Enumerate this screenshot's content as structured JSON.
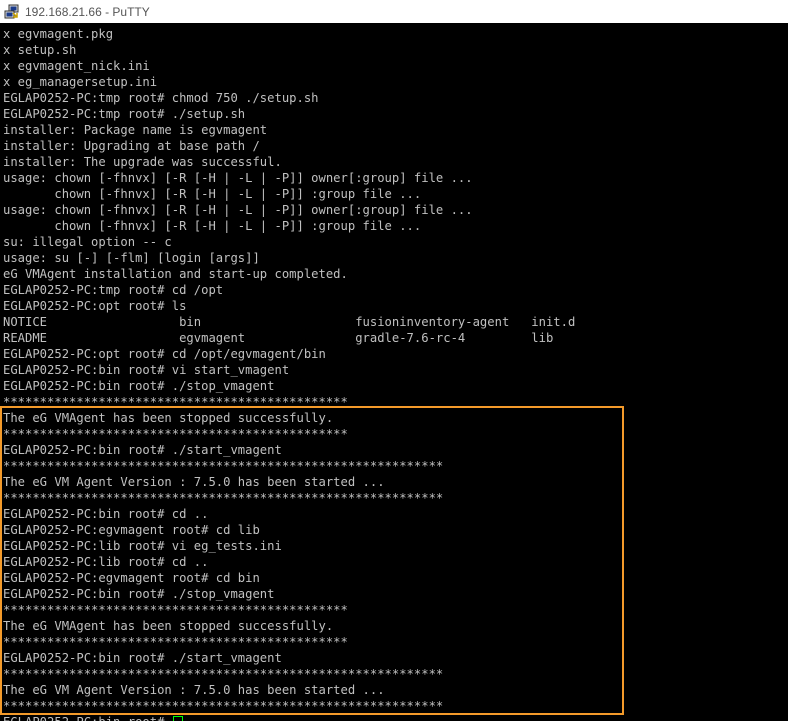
{
  "window": {
    "title": "192.168.21.66 - PuTTY",
    "icon": "putty-icon"
  },
  "terminal": {
    "lines": [
      "x egvmagent.pkg",
      "x setup.sh",
      "x egvmagent_nick.ini",
      "x eg_managersetup.ini",
      "EGLAP0252-PC:tmp root# chmod 750 ./setup.sh",
      "EGLAP0252-PC:tmp root# ./setup.sh",
      "installer: Package name is egvmagent",
      "installer: Upgrading at base path /",
      "installer: The upgrade was successful.",
      "usage: chown [-fhnvx] [-R [-H | -L | -P]] owner[:group] file ...",
      "       chown [-fhnvx] [-R [-H | -L | -P]] :group file ...",
      "usage: chown [-fhnvx] [-R [-H | -L | -P]] owner[:group] file ...",
      "       chown [-fhnvx] [-R [-H | -L | -P]] :group file ...",
      "su: illegal option -- c",
      "usage: su [-] [-flm] [login [args]]",
      "eG VMAgent installation and start-up completed.",
      "EGLAP0252-PC:tmp root# cd /opt",
      "EGLAP0252-PC:opt root# ls",
      "NOTICE                  bin                     fusioninventory-agent   init.d",
      "README                  egvmagent               gradle-7.6-rc-4         lib",
      "EGLAP0252-PC:opt root# cd /opt/egvmagent/bin",
      "EGLAP0252-PC:bin root# vi start_vmagent",
      "EGLAP0252-PC:bin root# ./stop_vmagent",
      "***********************************************",
      "The eG VMAgent has been stopped successfully.",
      "***********************************************",
      "EGLAP0252-PC:bin root# ./start_vmagent",
      "************************************************************",
      "The eG VM Agent Version : 7.5.0 has been started ...",
      "************************************************************",
      "EGLAP0252-PC:bin root# cd ..",
      "EGLAP0252-PC:egvmagent root# cd lib",
      "EGLAP0252-PC:lib root# vi eg_tests.ini",
      "EGLAP0252-PC:lib root# cd ..",
      "EGLAP0252-PC:egvmagent root# cd bin",
      "EGLAP0252-PC:bin root# ./stop_vmagent",
      "***********************************************",
      "The eG VMAgent has been stopped successfully.",
      "***********************************************",
      "EGLAP0252-PC:bin root# ./start_vmagent",
      "************************************************************",
      "The eG VM Agent Version : 7.5.0 has been started ...",
      "************************************************************"
    ],
    "prompt": "EGLAP0252-PC:bin root# "
  },
  "colors": {
    "terminal_bg": "#000000",
    "terminal_fg": "#c0c0c0",
    "cursor": "#00ff00",
    "highlight_border": "#f39a2a"
  }
}
